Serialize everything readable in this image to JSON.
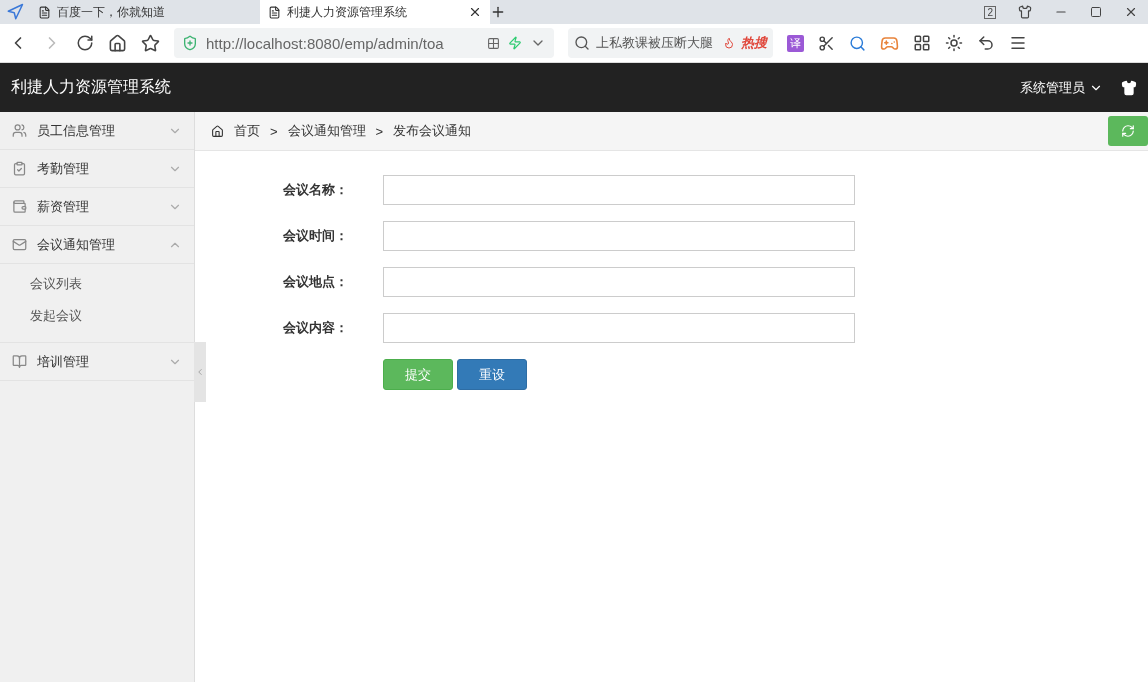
{
  "browser": {
    "tabs": [
      {
        "title": "百度一下，你就知道",
        "selected": false
      },
      {
        "title": "利捷人力资源管理系统",
        "selected": true
      }
    ],
    "tab_count": "2",
    "address": "http://localhost:8080/emp/admin/toa",
    "search": "上私教课被压断大腿",
    "hot_badge": "热搜",
    "translate_label": "译"
  },
  "app": {
    "title": "利捷人力资源管理系统",
    "user": "系统管理员"
  },
  "sidebar": {
    "items": [
      {
        "label": "员工信息管理",
        "expanded": false
      },
      {
        "label": "考勤管理",
        "expanded": false
      },
      {
        "label": "薪资管理",
        "expanded": false
      },
      {
        "label": "会议通知管理",
        "expanded": true,
        "children": [
          {
            "label": "会议列表"
          },
          {
            "label": "发起会议"
          }
        ]
      },
      {
        "label": "培训管理",
        "expanded": false
      }
    ]
  },
  "breadcrumb": [
    {
      "label": "首页"
    },
    {
      "separator": ">",
      "label": "会议通知管理"
    },
    {
      "separator": ">",
      "label": "发布会议通知"
    }
  ],
  "form": {
    "fields": [
      {
        "label": "会议名称："
      },
      {
        "label": "会议时间："
      },
      {
        "label": "会议地点："
      },
      {
        "label": "会议内容："
      }
    ],
    "buttons": [
      {
        "label": "提交",
        "kind": "submit"
      },
      {
        "label": "重设",
        "kind": "reset"
      }
    ]
  }
}
